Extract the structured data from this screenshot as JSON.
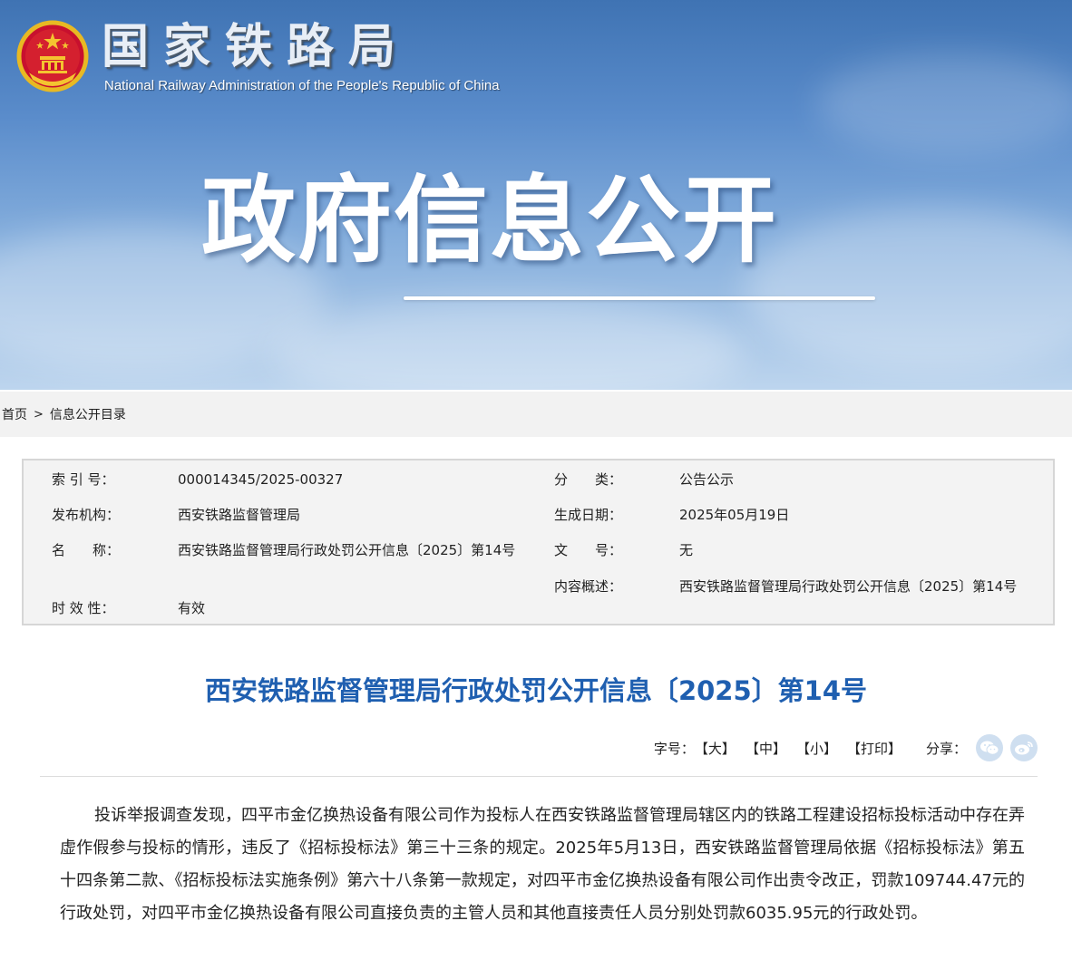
{
  "header": {
    "agency_name": "国家铁路局",
    "agency_name_en": "National Railway Administration of the People's Republic of China",
    "section_title": "政府信息公开",
    "emblem_icon": "national-emblem-icon"
  },
  "breadcrumb": {
    "items": [
      "首页",
      "信息公开目录"
    ],
    "separator": ">"
  },
  "info_table": {
    "index_label": "索 引 号：",
    "index_value": "000014345/2025-00327",
    "category_label": "分　　类：",
    "category_value": "公告公示",
    "publisher_label": "发布机构：",
    "publisher_value": "西安铁路监督管理局",
    "date_label": "生成日期：",
    "date_value": "2025年05月19日",
    "name_label": "名　　称：",
    "name_value": "西安铁路监督管理局行政处罚公开信息〔2025〕第14号",
    "docno_label": "文　　号：",
    "docno_value": "无",
    "summary_label": "内容概述：",
    "summary_value": "西安铁路监督管理局行政处罚公开信息〔2025〕第14号",
    "validity_label": "时 效 性：",
    "validity_value": "有效"
  },
  "article": {
    "title": "西安铁路监督管理局行政处罚公开信息〔2025〕第14号",
    "font_size_label": "字号：",
    "size_large": "【大】",
    "size_medium": "【中】",
    "size_small": "【小】",
    "print_label": "【打印】",
    "share_label": "分享：",
    "share_icons": [
      "wechat-icon",
      "weibo-icon"
    ],
    "body": "投诉举报调查发现，四平市金亿换热设备有限公司作为投标人在西安铁路监督管理局辖区内的铁路工程建设招标投标活动中存在弄虚作假参与投标的情形，违反了《招标投标法》第三十三条的规定。2025年5月13日，西安铁路监督管理局依据《招标投标法》第五十四条第二款、《招标投标法实施条例》第六十八条第一款规定，对四平市金亿换热设备有限公司作出责令改正，罚款109744.47元的行政处罚，对四平市金亿换热设备有限公司直接负责的主管人员和其他直接责任人员分别处罚款6035.95元的行政处罚。"
  },
  "colors": {
    "title_blue": "#1f5fb0",
    "banner_top": "#3f73b3",
    "banner_bottom": "#bdd5ee",
    "info_bg": "#f3f3f3",
    "share_icon_bg": "#cfdff0"
  }
}
